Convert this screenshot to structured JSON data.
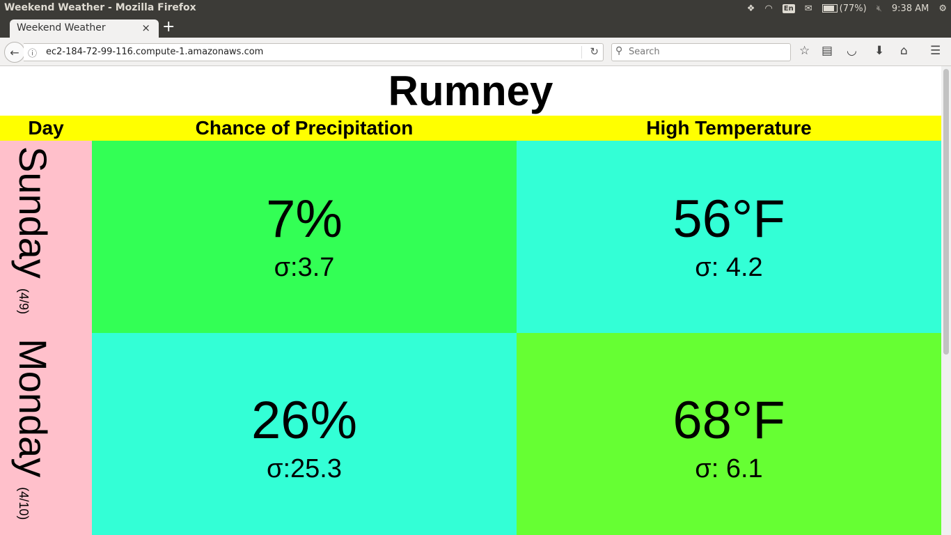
{
  "os": {
    "window_title": "Weekend Weather - Mozilla Firefox",
    "language": "En",
    "battery": "(77%)",
    "time": "9:38 AM"
  },
  "browser": {
    "tab_title": "Weekend Weather",
    "url": "ec2-184-72-99-116.compute-1.amazonaws.com",
    "search_placeholder": "Search"
  },
  "page": {
    "title": "Rumney",
    "headers": {
      "day": "Day",
      "precip": "Chance of Precipitation",
      "temp": "High Temperature"
    },
    "rows": [
      {
        "day": "Sunday",
        "date": "(4/9)",
        "precip": "7%",
        "precip_sigma": "σ:3.7",
        "precip_color": "#33ff55",
        "temp": "56°F",
        "temp_sigma": "σ: 4.2",
        "temp_color": "#33ffd6"
      },
      {
        "day": "Monday",
        "date": "(4/10)",
        "precip": "26%",
        "precip_sigma": "σ:25.3",
        "precip_color": "#33ffd6",
        "temp": "68°F",
        "temp_sigma": "σ: 6.1",
        "temp_color": "#66ff33"
      }
    ],
    "day_column_color": "#ffc0cb",
    "header_color": "#ffff00"
  }
}
